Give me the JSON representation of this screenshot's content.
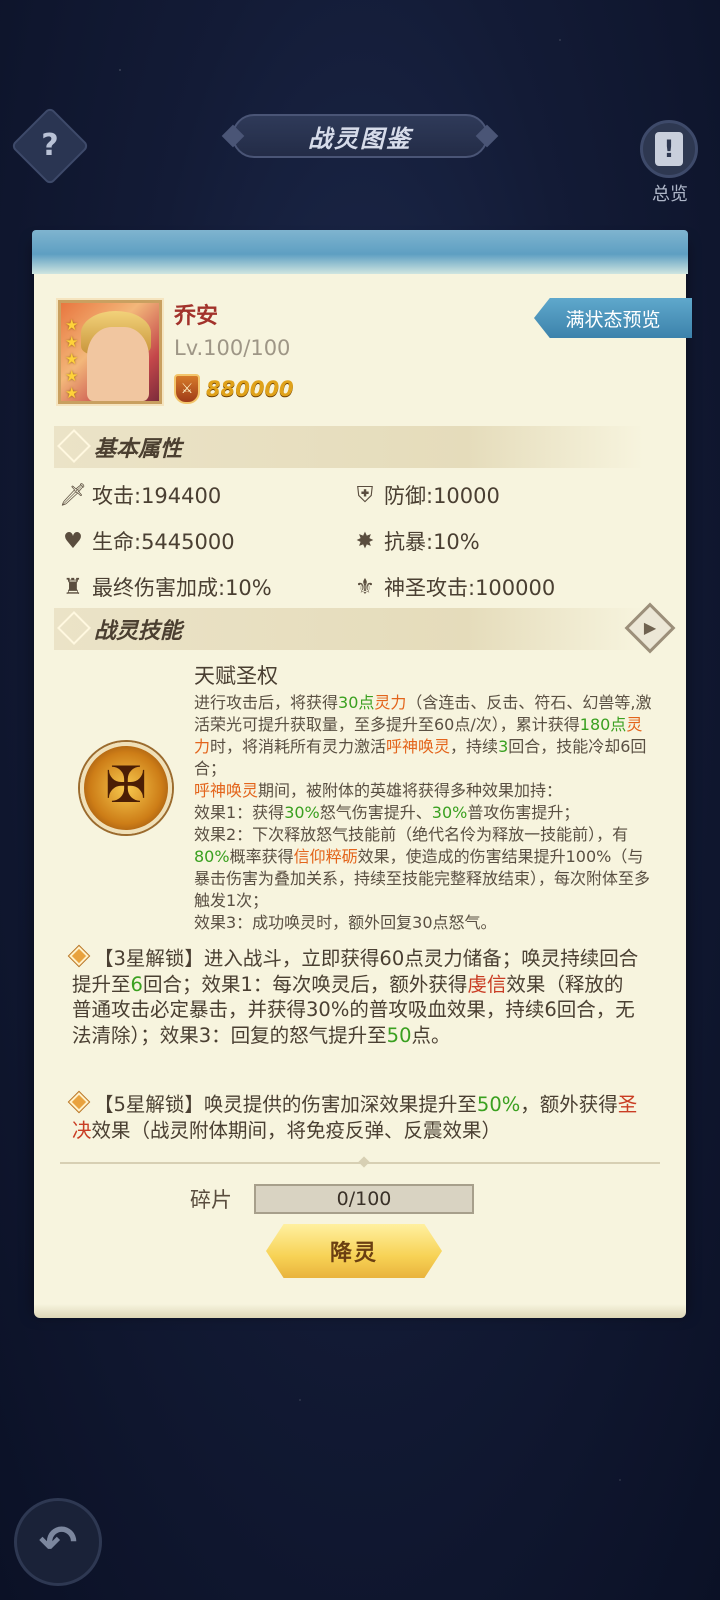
{
  "header": {
    "help_icon": "question-mark-icon",
    "title": "战灵图鉴",
    "overview_label": "总览",
    "overview_icon": "exclamation-icon"
  },
  "hero": {
    "name": "乔安",
    "level": "Lv.100/100",
    "stars": 5,
    "power": "880000",
    "preview_button": "满状态预览"
  },
  "basic": {
    "title": "基本属性",
    "attributes": [
      {
        "icon": "sword-icon",
        "text": "攻击:194400"
      },
      {
        "icon": "shield-icon",
        "text": "防御:10000"
      },
      {
        "icon": "heart-icon",
        "text": "生命:5445000"
      },
      {
        "icon": "crit-resist-icon",
        "text": "抗暴:10%"
      },
      {
        "icon": "final-damage-icon",
        "text": "最终伤害加成:10%"
      },
      {
        "icon": "holy-attack-icon",
        "text": "神圣攻击:100000"
      }
    ]
  },
  "skill": {
    "title": "战灵技能",
    "name": "天赋圣权",
    "icon": "holy-scepter-icon",
    "desc": [
      {
        "t": "进行攻击后，将获得",
        "c": ""
      },
      {
        "t": "30点",
        "c": "g"
      },
      {
        "t": "灵力",
        "c": "o"
      },
      {
        "t": "（含连击、反击、符石、幻兽等,激活荣光可提升获取量，至多提升至60点/次），累计获得",
        "c": ""
      },
      {
        "t": "180点",
        "c": "g"
      },
      {
        "t": "灵力",
        "c": "o"
      },
      {
        "t": "时，将消耗所有灵力激活",
        "c": ""
      },
      {
        "t": "呼神唤灵",
        "c": "o"
      },
      {
        "t": "，持续",
        "c": ""
      },
      {
        "t": "3",
        "c": "g"
      },
      {
        "t": "回合，技能冷却6回合；",
        "c": ""
      },
      {
        "t": "\n",
        "c": ""
      },
      {
        "t": "呼神唤灵",
        "c": "o"
      },
      {
        "t": "期间，被附体的英雄将获得多种效果加持：",
        "c": ""
      },
      {
        "t": "\n效果1：获得",
        "c": ""
      },
      {
        "t": "30%",
        "c": "g"
      },
      {
        "t": "怒气伤害提升、",
        "c": ""
      },
      {
        "t": "30%",
        "c": "g"
      },
      {
        "t": "普攻伤害提升；",
        "c": ""
      },
      {
        "t": "\n效果2：下次释放怒气技能前（绝代名伶为释放一技能前），有",
        "c": ""
      },
      {
        "t": "80%",
        "c": "g"
      },
      {
        "t": "概率获得",
        "c": ""
      },
      {
        "t": "信仰粹砺",
        "c": "o"
      },
      {
        "t": "效果，使造成的伤害结果提升100%（与暴击伤害为叠加关系，持续至技能完整释放结束），每次附体至多触发1次；",
        "c": ""
      },
      {
        "t": "\n效果3：成功唤灵时，额外回复30点怒气。",
        "c": ""
      }
    ]
  },
  "unlocks": [
    {
      "parts": [
        {
          "t": "【3星解锁】进入战斗，立即获得60点灵力储备；唤灵持续回合提升至",
          "c": ""
        },
        {
          "t": "6",
          "c": "g"
        },
        {
          "t": "回合；效果1：每次唤灵后，额外获得",
          "c": ""
        },
        {
          "t": "虔信",
          "c": "r"
        },
        {
          "t": "效果（释放的普通攻击必定暴击，并获得30%的普攻吸血效果，持续6回合，无法清除）；效果3：回复的怒气提升至",
          "c": ""
        },
        {
          "t": "50",
          "c": "g"
        },
        {
          "t": "点。",
          "c": ""
        }
      ]
    },
    {
      "parts": [
        {
          "t": "【5星解锁】唤灵提供的伤害加深效果提升至",
          "c": ""
        },
        {
          "t": "50%",
          "c": "g"
        },
        {
          "t": "，额外获得",
          "c": ""
        },
        {
          "t": "圣决",
          "c": "r"
        },
        {
          "t": "效果（战灵附体期间，将免疫反弹、反震效果）",
          "c": ""
        }
      ]
    }
  ],
  "shard": {
    "label": "碎片",
    "progress": "0/100",
    "fraction": 0
  },
  "action_button": "降灵",
  "back_icon": "back-arrow-icon"
}
